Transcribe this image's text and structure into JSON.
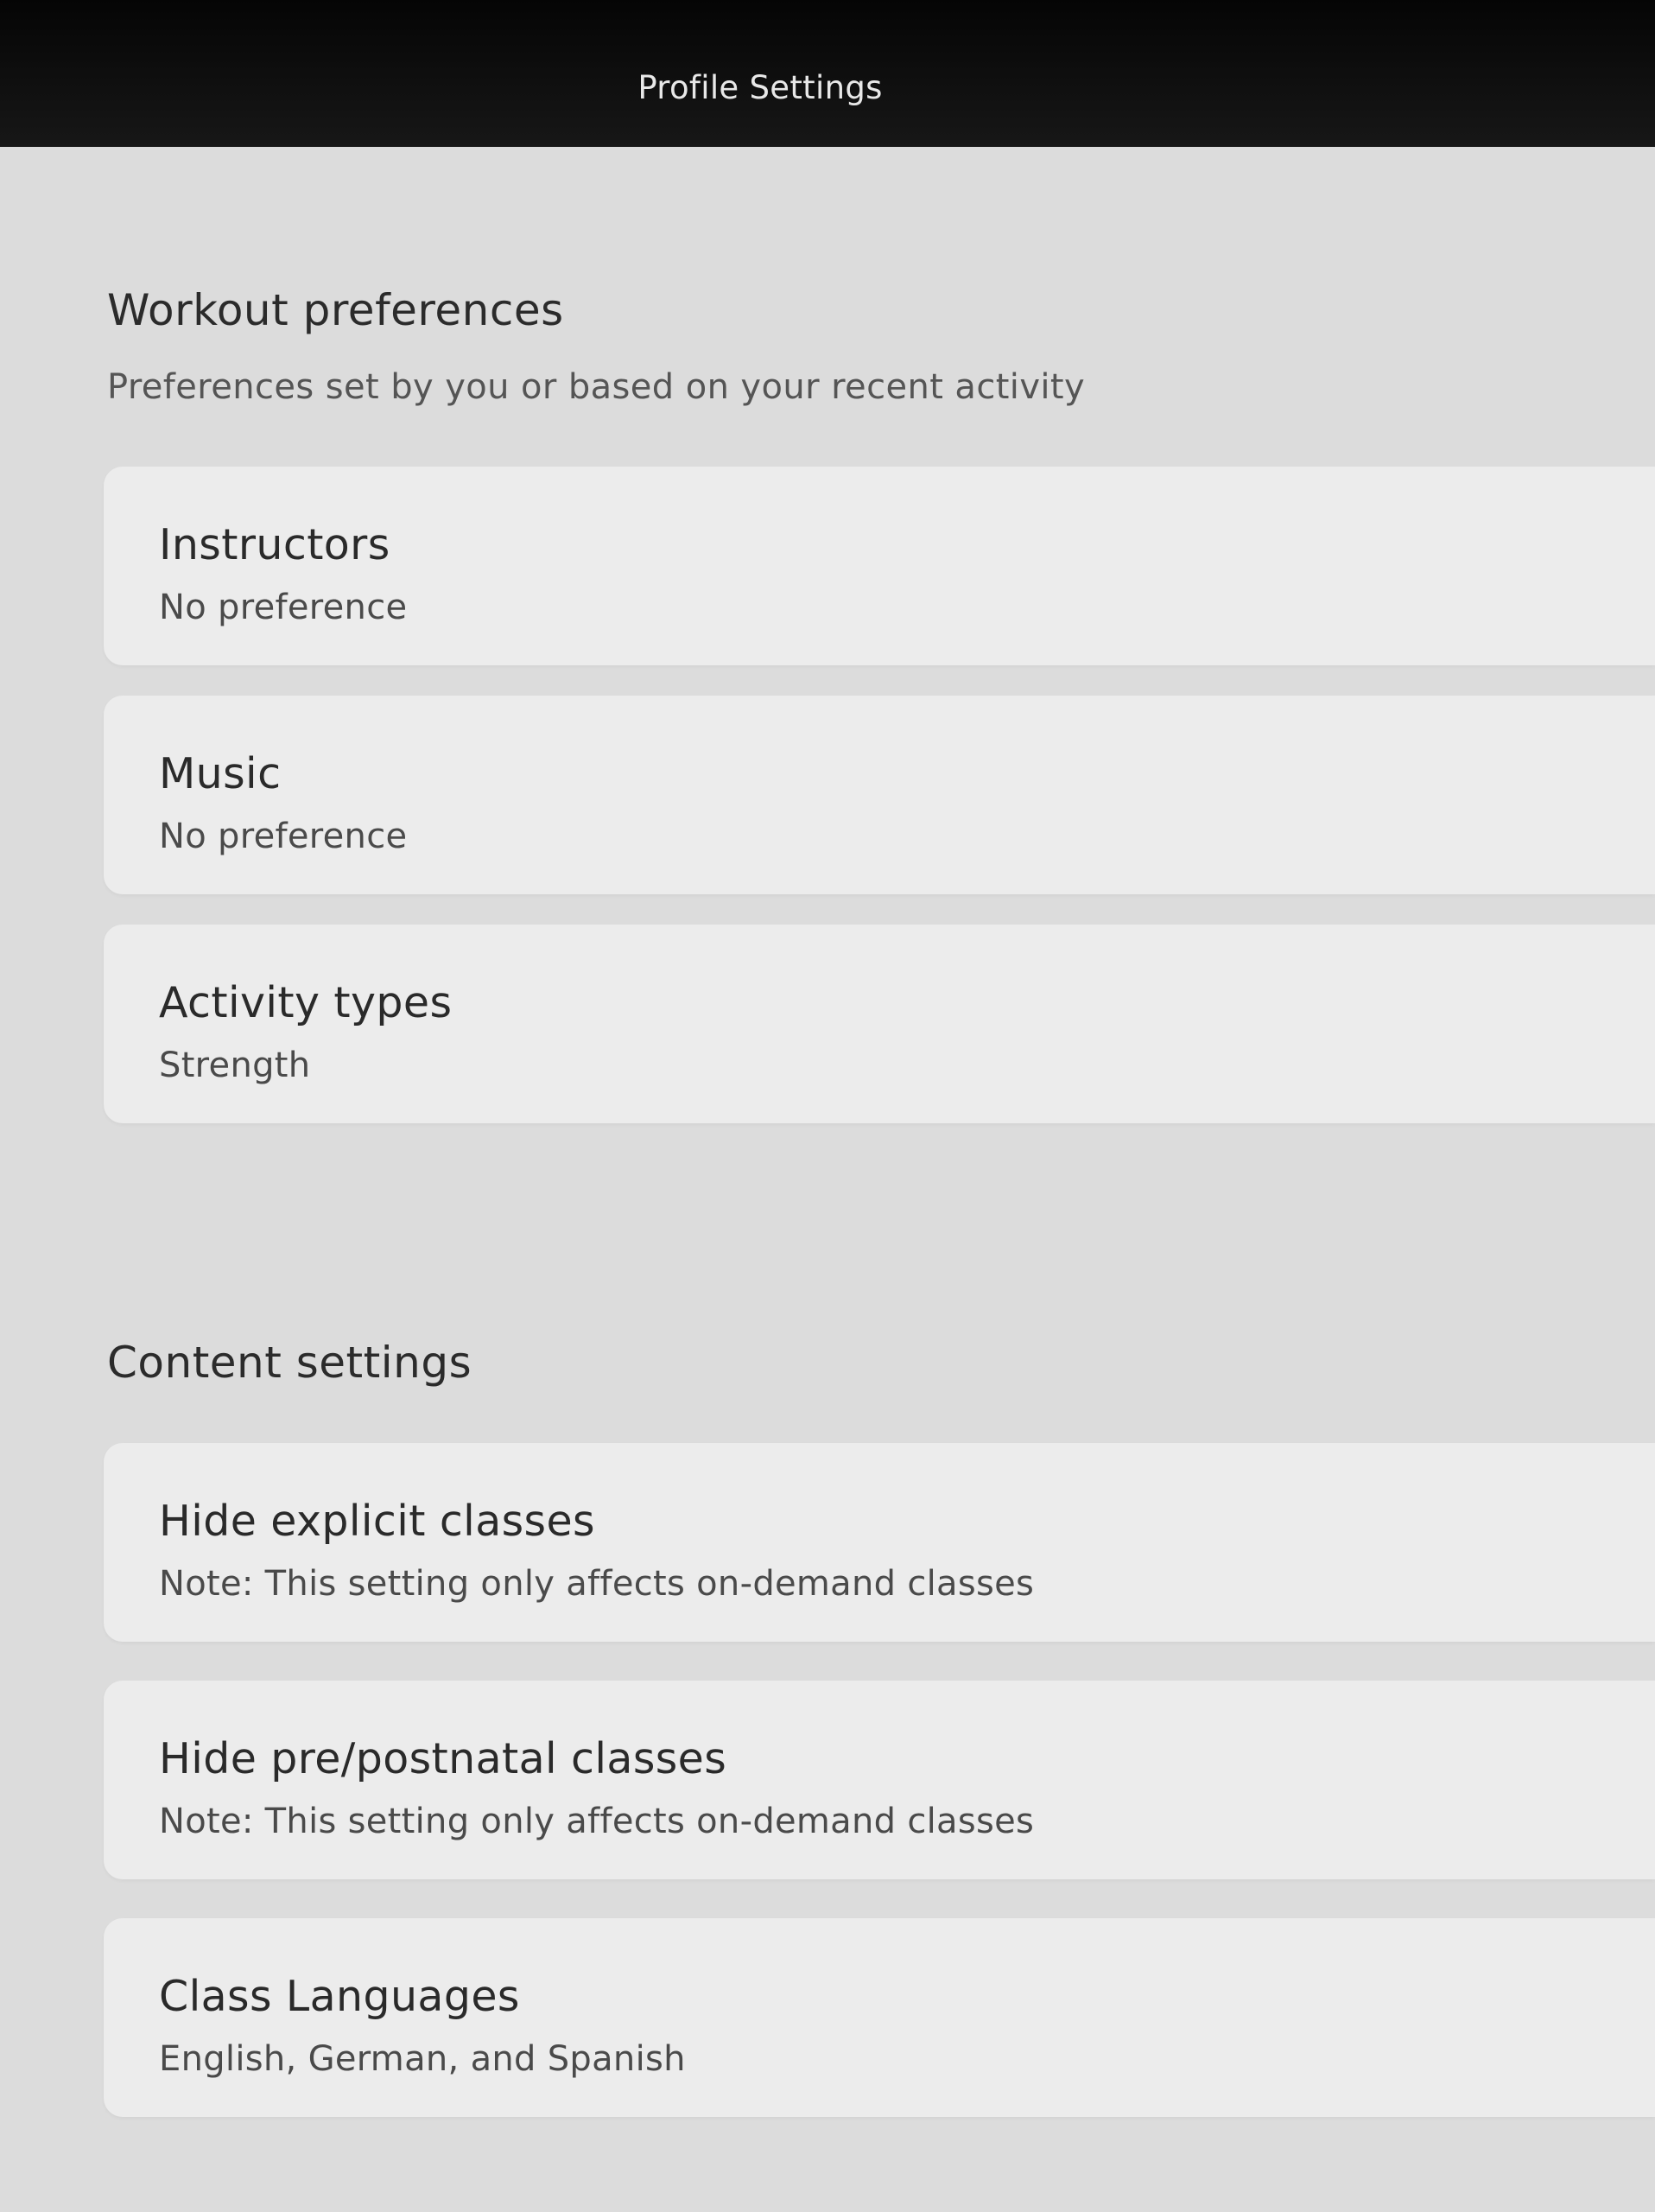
{
  "header": {
    "title": "Profile Settings"
  },
  "workout_preferences": {
    "title": "Workout preferences",
    "subtitle": "Preferences set by you or based on your recent activity",
    "items": [
      {
        "label": "Instructors",
        "value": "No preference"
      },
      {
        "label": "Music",
        "value": "No preference"
      },
      {
        "label": "Activity types",
        "value": "Strength"
      }
    ]
  },
  "content_settings": {
    "title": "Content settings",
    "items": [
      {
        "label": "Hide explicit classes",
        "value": "Note: This setting only affects on-demand classes"
      },
      {
        "label": "Hide pre/postnatal classes",
        "value": "Note: This setting only affects on-demand classes"
      },
      {
        "label": "Class Languages",
        "value": "English, German, and Spanish"
      }
    ]
  },
  "colors": {
    "header_background": "#0d0d0d",
    "page_background": "#dcdcdc",
    "card_background": "#ececec"
  }
}
